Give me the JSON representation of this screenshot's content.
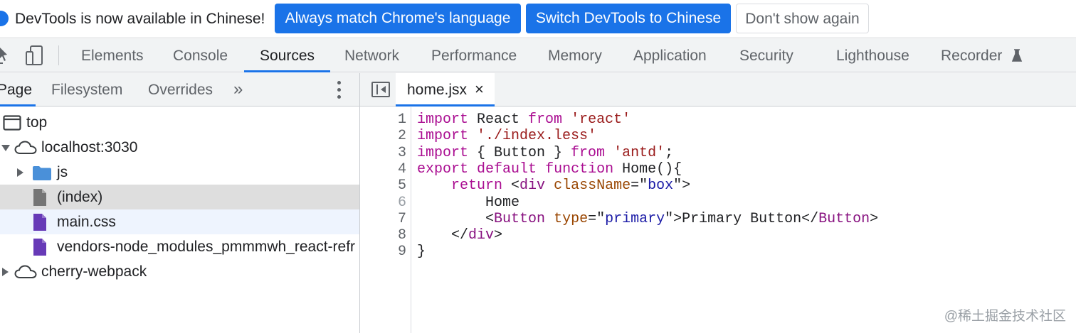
{
  "infobar": {
    "message": "DevTools is now available in Chinese!",
    "match_language_label": "Always match Chrome's language",
    "switch_label": "Switch DevTools to Chinese",
    "dismiss_label": "Don't show again"
  },
  "toolbar": {
    "tabs": [
      "Elements",
      "Console",
      "Sources",
      "Network",
      "Performance",
      "Memory",
      "Application",
      "Security",
      "Lighthouse",
      "Recorder"
    ],
    "active_tab": "Sources"
  },
  "navigator": {
    "tabs": [
      "Page",
      "Filesystem",
      "Overrides"
    ],
    "more_label": "»",
    "tree": [
      {
        "label": "top",
        "icon": "frame-icon"
      },
      {
        "label": "localhost:3030",
        "icon": "cloud-icon",
        "expanded": true
      },
      {
        "label": "js",
        "icon": "folder-icon",
        "expanded": false
      },
      {
        "label": "(index)",
        "icon": "document-icon",
        "selected": true
      },
      {
        "label": "main.css",
        "icon": "stylesheet-file-icon"
      },
      {
        "label": "vendors-node_modules_pmmmwh_react-refr",
        "icon": "script-file-icon"
      },
      {
        "label": "cherry-webpack",
        "icon": "cloud-icon",
        "expanded": false
      }
    ]
  },
  "editor": {
    "file_tab": "home.jsx",
    "close_glyph": "×",
    "line_numbers": [
      "1",
      "2",
      "3",
      "4",
      "5",
      "6",
      "7",
      "8",
      "9"
    ],
    "lines": [
      "import React from 'react'",
      "import './index.less'",
      "import { Button } from 'antd';",
      "export default function Home(){",
      "    return <div className=\"box\">",
      "        Home",
      "        <Button type=\"primary\">Primary Button</Button>",
      "    </div>",
      "}"
    ]
  },
  "watermark": "@稀土掘金技术社区",
  "colors": {
    "accent": "#1a73e8",
    "toolbar_bg": "#f1f3f4",
    "selected_row": "#dedede",
    "keyword": "#aa0d91",
    "string": "#9a1b1b"
  }
}
